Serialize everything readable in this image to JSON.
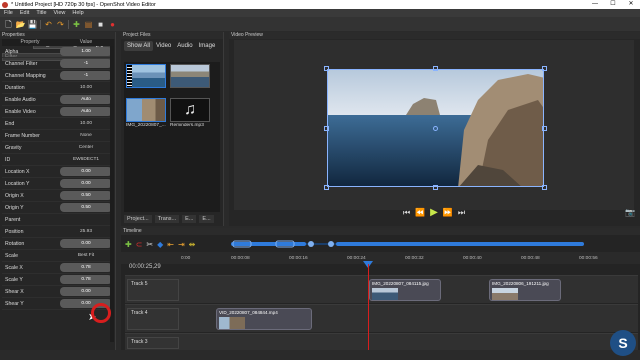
{
  "window": {
    "title": "* Untitled Project [HD 720p 30 fps] - OpenShot Video Editor",
    "minimize": "—",
    "maximize": "☐",
    "close": "✕"
  },
  "menu": [
    "File",
    "Edit",
    "Title",
    "View",
    "Help"
  ],
  "toolbar": [
    {
      "icon": "new-project-icon",
      "glyph": "🗋",
      "color": "#eeeeee"
    },
    {
      "icon": "open-project-icon",
      "glyph": "📂",
      "color": "#e8b84a"
    },
    {
      "icon": "save-project-icon",
      "glyph": "💾",
      "color": "#6aa84f"
    },
    {
      "icon": "undo-icon",
      "glyph": "↶",
      "color": "#e89a2b"
    },
    {
      "icon": "redo-icon",
      "glyph": "↷",
      "color": "#e89a2b"
    },
    {
      "icon": "import-files-icon",
      "glyph": "✚",
      "color": "#7ac043"
    },
    {
      "icon": "profile-icon",
      "glyph": "▤",
      "color": "#c47a2c"
    },
    {
      "icon": "fullscreen-icon",
      "glyph": "■",
      "color": "#dddddd"
    },
    {
      "icon": "export-video-icon",
      "glyph": "●",
      "color": "#e03030"
    }
  ],
  "properties": {
    "title": "Properties",
    "selection_label": "Selection:",
    "selection_value": "IMG_20220807_084115.jpg",
    "filter_placeholder": "Filter",
    "col_property": "Property",
    "col_value": "Value",
    "rows": [
      {
        "name": "Alpha",
        "value": "1.00",
        "style": "bar"
      },
      {
        "name": "Channel Filter",
        "value": "-1",
        "style": "bar"
      },
      {
        "name": "Channel Mapping",
        "value": "-1",
        "style": "bar"
      },
      {
        "name": "Duration",
        "value": "10.00",
        "style": "plain"
      },
      {
        "name": "Enable Audio",
        "value": "Auto",
        "style": "bar"
      },
      {
        "name": "Enable Video",
        "value": "Auto",
        "style": "bar"
      },
      {
        "name": "End",
        "value": "10.00",
        "style": "plain"
      },
      {
        "name": "Frame Number",
        "value": "None",
        "style": "plain"
      },
      {
        "name": "Gravity",
        "value": "Center",
        "style": "plain"
      },
      {
        "name": "ID",
        "value": "EW6DECT1",
        "style": "plain"
      },
      {
        "name": "Location X",
        "value": "0.00",
        "style": "bar"
      },
      {
        "name": "Location Y",
        "value": "0.00",
        "style": "bar"
      },
      {
        "name": "Origin X",
        "value": "0.50",
        "style": "bar"
      },
      {
        "name": "Origin Y",
        "value": "0.50",
        "style": "bar"
      },
      {
        "name": "Parent",
        "value": "",
        "style": "plain"
      },
      {
        "name": "Position",
        "value": "25.93",
        "style": "plain"
      },
      {
        "name": "Rotation",
        "value": "0.00",
        "style": "bar"
      },
      {
        "name": "Scale",
        "value": "Best Fit",
        "style": "plain"
      },
      {
        "name": "Scale X",
        "value": "0.78",
        "style": "bar"
      },
      {
        "name": "Scale Y",
        "value": "0.78",
        "style": "bar"
      },
      {
        "name": "Shear X",
        "value": "0.00",
        "style": "bar"
      },
      {
        "name": "Shear Y",
        "value": "0.00",
        "style": "bar"
      }
    ]
  },
  "project_files": {
    "title": "Project Files",
    "tabs": [
      "Show All",
      "Video",
      "Audio",
      "Image"
    ],
    "items": [
      {
        "name": "",
        "kind": "video"
      },
      {
        "name": "",
        "kind": "image"
      },
      {
        "name": "IMG_20220807_...",
        "kind": "image"
      },
      {
        "name": "Reminders.mp3",
        "kind": "audio"
      }
    ],
    "bottom_tabs": [
      "Project...",
      "Trans...",
      "E...",
      "E..."
    ]
  },
  "preview": {
    "title": "Video Preview"
  },
  "timeline": {
    "title": "Timeline",
    "timecode": "00:00:25,29",
    "ticks": [
      "0:00",
      "00:00:08",
      "00:00:16",
      "00:00:24",
      "00:00:32",
      "00:00:40",
      "00:00:48",
      "00:00:56"
    ],
    "tracks": [
      {
        "name": "Track 5",
        "clips": [
          {
            "name": "IMG_20220807_084115.jpg"
          },
          {
            "name": "IMG_20220806_191211.jpg"
          }
        ]
      },
      {
        "name": "Track 4",
        "clips": [
          {
            "name": "VID_20220807_084844.mp4"
          }
        ]
      },
      {
        "name": "Track 3",
        "clips": []
      }
    ]
  },
  "colors": {
    "accent": "#2f7bdb",
    "playhead": "#d81e1e",
    "play_button": "#c8e84a"
  }
}
